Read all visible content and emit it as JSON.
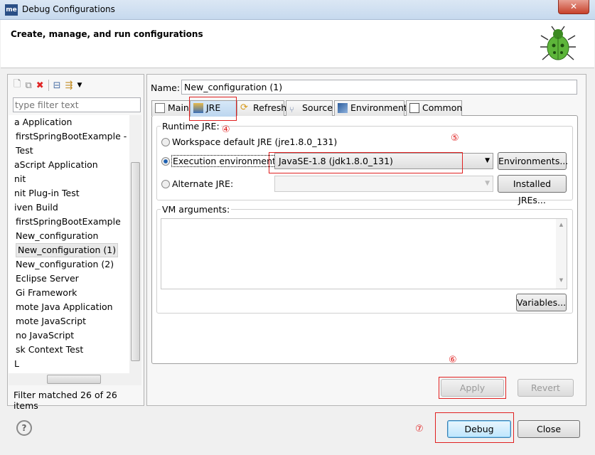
{
  "window": {
    "title": "Debug Configurations",
    "app_icon": "me"
  },
  "header": {
    "title": "Create, manage, and run configurations",
    "icon": "bug-icon"
  },
  "sidebar": {
    "toolbar": [
      "new-config-icon",
      "duplicate-icon",
      "delete-icon",
      "collapse-all-icon",
      "filter-icon",
      "dropdown-icon"
    ],
    "filter_placeholder": "type filter text",
    "items": [
      "a Application",
      "firstSpringBootExample - E:",
      "Test",
      "aScript Application",
      "nit",
      "nit Plug-in Test",
      "iven Build",
      "firstSpringBootExample",
      "New_configuration",
      "New_configuration (1)",
      "New_configuration (2)",
      "Eclipse Server",
      "Gi Framework",
      "mote Java Application",
      "mote JavaScript",
      "no JavaScript",
      "sk Context Test",
      "L"
    ],
    "selected_index": 9,
    "status": "Filter matched 26 of 26 items"
  },
  "main": {
    "name_label": "Name:",
    "name_value": "New_configuration (1)",
    "tabs": [
      "Main",
      "JRE",
      "Refresh",
      "Source",
      "Environment",
      "Common"
    ],
    "active_tab": "JRE",
    "runtime_jre_label": "Runtime JRE:",
    "workspace_default": "Workspace default JRE (jre1.8.0_131)",
    "execution_env": "Execution environment:",
    "execution_env_value": "JavaSE-1.8 (jdk1.8.0_131)",
    "environments_button": "Environments...",
    "alternate_jre": "Alternate JRE:",
    "installed_jres_button": "Installed JREs...",
    "selected_radio": "execution_env",
    "vm_args_label": "VM arguments:",
    "vm_args_value": "",
    "variables_button": "Variables...",
    "apply_button": "Apply",
    "revert_button": "Revert"
  },
  "footer": {
    "debug_button": "Debug",
    "close_button": "Close",
    "help_icon": "?"
  },
  "annotations": [
    "④",
    "⑤",
    "⑥",
    "⑦"
  ],
  "colors": {
    "annotation": "#e02020",
    "selection": "#e8e8e8"
  }
}
